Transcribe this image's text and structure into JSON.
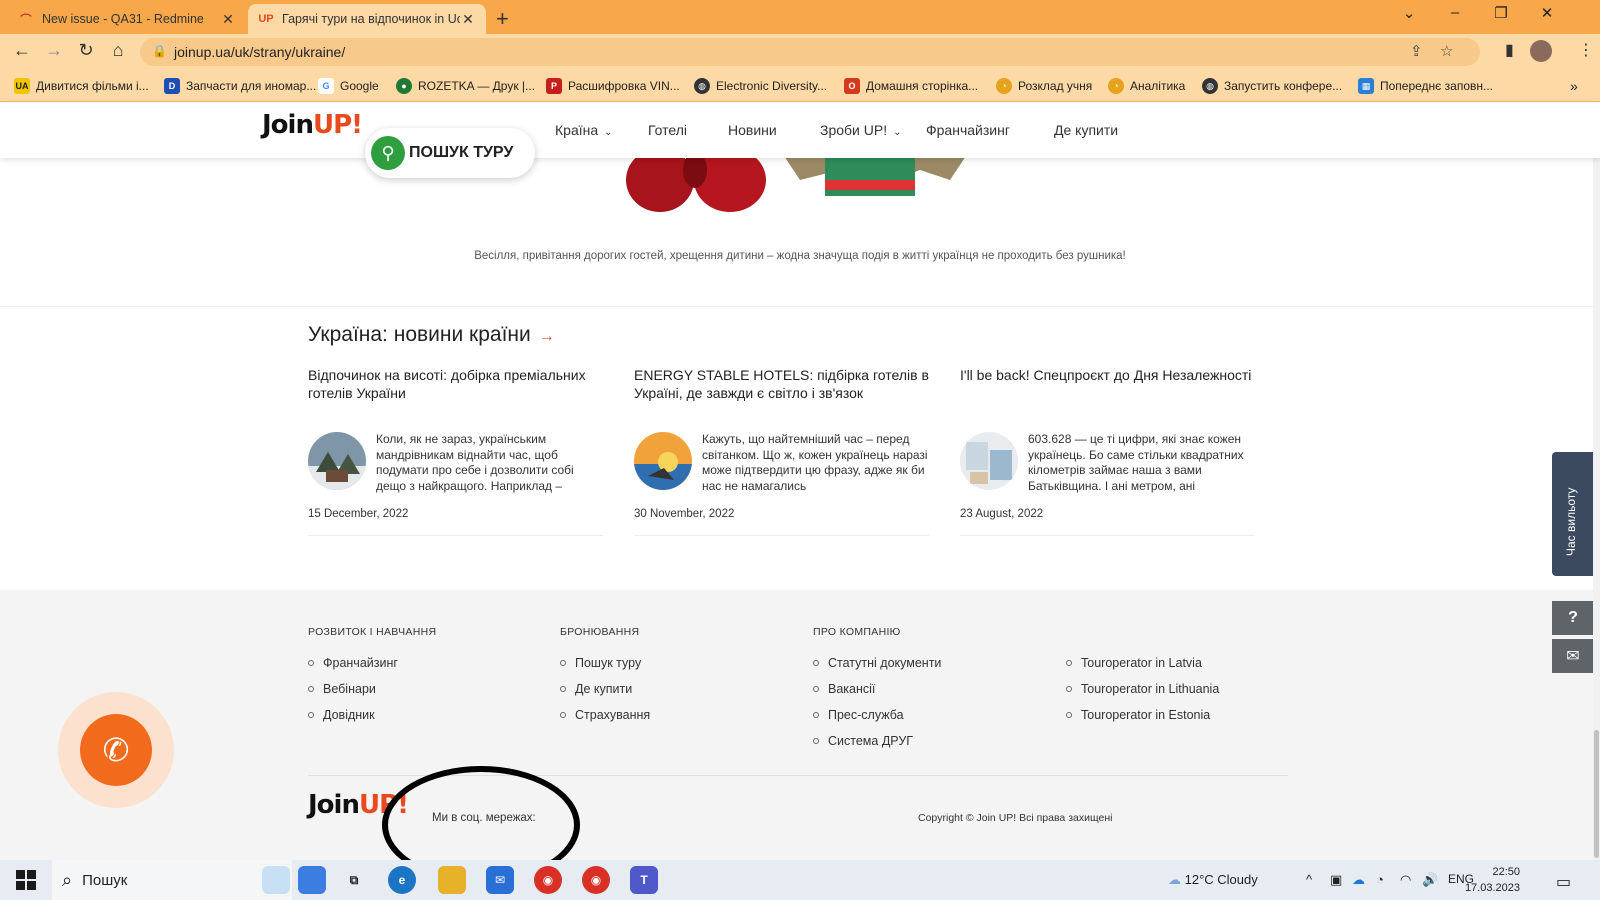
{
  "browser": {
    "tabs": [
      {
        "title": "New issue - QA31 - Redmine",
        "active": false
      },
      {
        "title": "Гарячі тури на відпочинок in Uc",
        "active": true
      }
    ],
    "url": "joinup.ua/uk/strany/ukraine/",
    "bookmarks": [
      {
        "label": "Дивитися фільми і...",
        "icon": "ua-icon",
        "color": "#f2c400"
      },
      {
        "label": "Запчасти для иномар...",
        "icon": "d-icon",
        "color": "#1e4fb5"
      },
      {
        "label": "Google",
        "icon": "google-icon",
        "color": "#4285f4"
      },
      {
        "label": "ROZETKA — Друк |...",
        "icon": "rozetka-icon",
        "color": "#1e7a32"
      },
      {
        "label": "Расшифровка VIN...",
        "icon": "p-icon",
        "color": "#c81d1d"
      },
      {
        "label": "Electronic Diversity...",
        "icon": "globe-icon",
        "color": "#333333"
      },
      {
        "label": "Домашня сторінка...",
        "icon": "office-icon",
        "color": "#d43b1e"
      },
      {
        "label": "Розклад учня",
        "icon": "schedule-icon",
        "color": "#e6a21a"
      },
      {
        "label": "Аналітика",
        "icon": "analytics-icon",
        "color": "#e6a21a"
      },
      {
        "label": "Запустить конфере...",
        "icon": "globe-icon",
        "color": "#333333"
      },
      {
        "label": "Попереднє заповн...",
        "icon": "form-icon",
        "color": "#2c7fd6"
      }
    ]
  },
  "site": {
    "logo": {
      "join": "Join",
      "up": "UP!"
    },
    "search_tour": "ПОШУК ТУРУ",
    "nav": [
      "Країна",
      "Готелі",
      "Новини",
      "Зроби UP!",
      "Франчайзинг",
      "Де купити"
    ],
    "caption": "Весілля, привітання дорогих гостей, хрещення дитини – жодна значуща подія в житті українця не проходить без рушника!",
    "news_section_title": "Україна: новини країни",
    "news": [
      {
        "title": "Відпочинок на висоті: добірка преміальних готелів України",
        "excerpt": "Коли, як не зараз, українським мандрівникам віднайти час, щоб подумати про себе і дозволити собі дещо з найкращого. Наприклад –",
        "date": "15 December, 2022"
      },
      {
        "title": "ENERGY STABLE HOTELS: підбірка готелів в Україні, де завжди є світло і зв'язок",
        "excerpt": "Кажуть, що найтемніший час – перед світанком. Що ж, кожен українець наразі може підтвердити цю фразу, адже як би нас не намагались",
        "date": "30 November, 2022"
      },
      {
        "title": "I'll be back! Спецпроєкт до Дня Незалежності",
        "excerpt": "603.628 — це ті цифри, які знає кожен українець. Бо саме стільки квадратних кілометрів займає наша з вами Батьківщина. І ані метром, ані",
        "date": "23 August, 2022"
      }
    ],
    "footer": {
      "columns": [
        {
          "title": "РОЗВИТОК І НАВЧАННЯ",
          "links": [
            "Франчайзинг",
            "Вебінари",
            "Довідник"
          ]
        },
        {
          "title": "БРОНЮВАННЯ",
          "links": [
            "Пошук туру",
            "Де купити",
            "Страхування"
          ]
        },
        {
          "title": "ПРО КОМПАНІЮ",
          "links": [
            "Статутні документи",
            "Вакансії",
            "Прес-служба",
            "Система ДРУГ"
          ]
        },
        {
          "title": "",
          "links": [
            "Touroperator in Latvia",
            "Touroperator in Lithuania",
            "Touroperator in Estonia"
          ]
        }
      ],
      "social_label": "Ми в соц. мережах:",
      "copyright": "Copyright © Join UP! Всі права захищені"
    },
    "side_panel": "Час вильоту",
    "side_help": "?",
    "side_mail": "✉"
  },
  "taskbar": {
    "search_placeholder": "Пошук",
    "weather": "12°C  Cloudy",
    "language": "ENG",
    "time": "22:50",
    "date": "17.03.2023"
  }
}
